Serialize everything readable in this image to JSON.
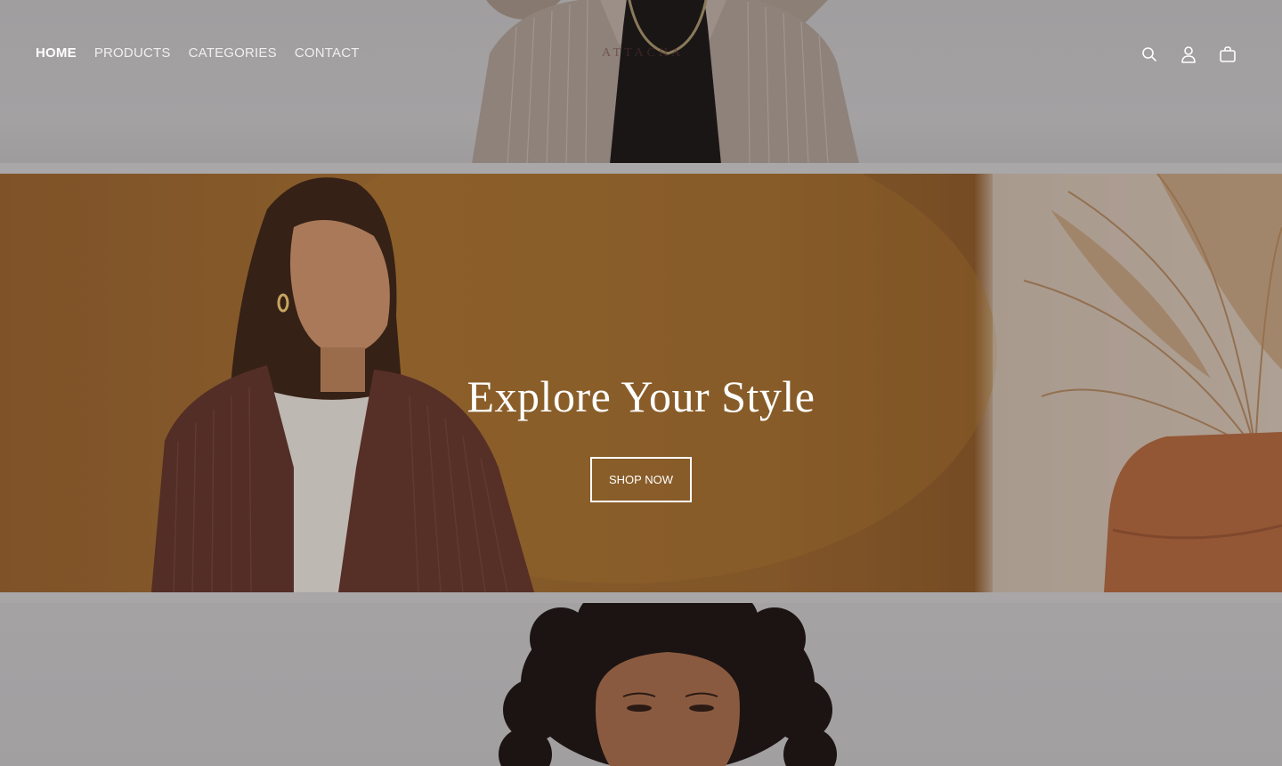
{
  "nav": {
    "items": [
      {
        "label": "HOME",
        "active": true
      },
      {
        "label": "PRODUCTS"
      },
      {
        "label": "CATEGORIES"
      },
      {
        "label": "CONTACT"
      }
    ]
  },
  "brand": {
    "logo_text": "ATTACHA"
  },
  "header_icons": [
    "search-icon",
    "account-icon",
    "cart-icon"
  ],
  "hero": {
    "title": "Explore Your Style",
    "cta_label": "SHOP NOW"
  },
  "colors": {
    "overlay_grey": "#9e9c9d",
    "hero_mustard": "#97662f",
    "text_white": "#ffffff"
  }
}
